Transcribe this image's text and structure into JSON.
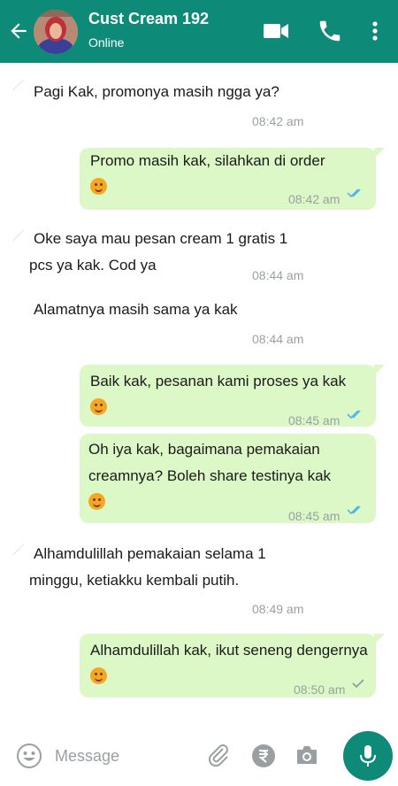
{
  "header": {
    "contact_name": "Cust Cream 192",
    "status": "Online",
    "icons": [
      "back-arrow-icon",
      "video-call-icon",
      "voice-call-icon",
      "more-options-icon"
    ]
  },
  "messages": [
    {
      "dir": "in",
      "text": "Pagi Kak, promonya masih ngga ya?",
      "time": "08:42 am"
    },
    {
      "dir": "out",
      "text": "Promo masih kak, silahkan di order",
      "emoji": "smiling-face",
      "time": "08:42 am",
      "status": "read"
    },
    {
      "dir": "in",
      "text": "Oke saya mau pesan cream 1 gratis 1 pcs ya kak. Cod ya",
      "time": "08:44 am"
    },
    {
      "dir": "in",
      "text": "Alamatnya masih sama ya kak",
      "time": "08:44 am"
    },
    {
      "dir": "out",
      "text": "Baik kak, pesanan kami proses ya kak",
      "emoji": "smiling-face",
      "time": "08:45 am",
      "status": "read"
    },
    {
      "dir": "out",
      "text": "Oh iya kak, bagaimana pemakaian creamnya? Boleh share testinya kak",
      "emoji": "smiling-face",
      "time": "08:45 am",
      "status": "read"
    },
    {
      "dir": "in",
      "text": "Alhamdulillah pemakaian selama 1 minggu, ketiakku kembali putih.",
      "time": "08:49 am"
    },
    {
      "dir": "out",
      "text": "Alhamdulillah kak, ikut seneng dengernya",
      "emoji": "smiling-face",
      "time": "08:50 am",
      "status": "delivered"
    }
  ],
  "input": {
    "placeholder": "Message",
    "icons": [
      "emoji-icon",
      "attach-icon",
      "rupee-payment-icon",
      "camera-icon",
      "mic-icon"
    ]
  },
  "colors": {
    "header": "#0e8a79",
    "outgoing_bubble": "#dcf8c6",
    "read_ticks": "#4fb6ec",
    "timestamp": "#9aa0a2"
  }
}
